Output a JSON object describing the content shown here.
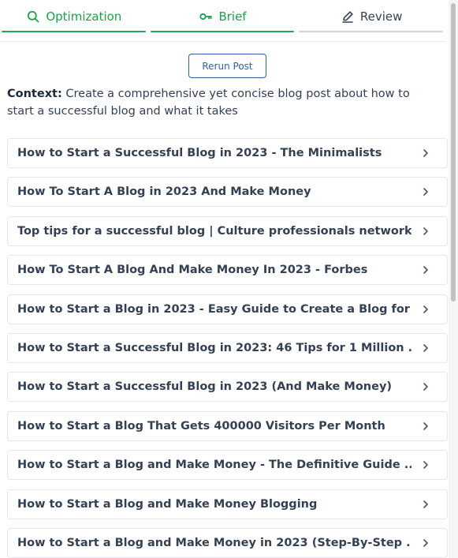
{
  "tabs": [
    {
      "label": "Optimization",
      "icon": "search-icon",
      "active": true
    },
    {
      "label": "Brief",
      "icon": "key-icon",
      "active": true
    },
    {
      "label": "Review",
      "icon": "pen-icon",
      "active": false
    }
  ],
  "rerun_label": "Rerun Post",
  "context": {
    "label": "Context:",
    "text": " Create a comprehensive yet concise blog post about how to start a successful blog and what it takes"
  },
  "results": [
    "How to Start a Successful Blog in 2023 - The Minimalists",
    "How To Start A Blog in 2023 And Make Money",
    "Top tips for a successful blog | Culture professionals network",
    "How To Start A Blog And Make Money In 2023 - Forbes",
    "How to Start a Blog in 2023 - Easy Guide to Create a Blog for ...",
    "How to Start a Successful Blog in 2023: 46 Tips for 1 Million ...",
    "How to Start a Successful Blog in 2023 (And Make Money)",
    "How to Start a Blog That Gets 400000 Visitors Per Month",
    "How to Start a Blog and Make Money - The Definitive Guide ...",
    "How to Start a Blog and Make Money Blogging",
    "How to Start a Blog and Make Money in 2023 (Step-By-Step ..."
  ],
  "colors": {
    "accent_green": "#22a559",
    "button_blue": "#2f5fa8"
  }
}
